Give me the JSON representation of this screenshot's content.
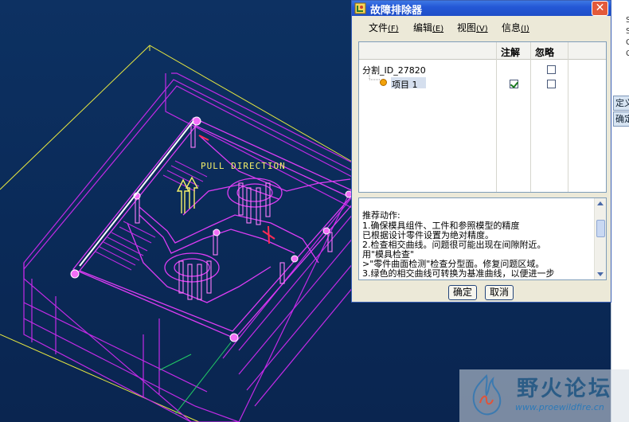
{
  "viewport": {
    "pull_direction_label": "PULL DIRECTION",
    "colors": {
      "background": "#0b2c5a",
      "outline_primary": "#cc2cf0",
      "outline_secondary": "#ff8cff",
      "boundary": "#e8e840",
      "highlight": "#ffffff",
      "edge_green": "#22cc66"
    }
  },
  "dialog": {
    "title": "故障排除器",
    "close_label": "✕",
    "menu": [
      {
        "label": "文件",
        "key": "(F)"
      },
      {
        "label": "编辑",
        "key": "(E)"
      },
      {
        "label": "视图",
        "key": "(V)"
      },
      {
        "label": "信息",
        "key": "(I)"
      }
    ],
    "tree": {
      "columns": [
        "注解",
        "忽略"
      ],
      "rows": [
        {
          "label": "分割_ID_27820",
          "annotate": false,
          "ignore": false
        },
        {
          "label": "项目 1",
          "annotate": true,
          "ignore": false
        }
      ]
    },
    "info": {
      "lines": [
        "推荐动作:",
        "1.确保模具组件、工件和参照模型的精度",
        "    已根据设计零件设置为绝对精度。",
        "2.检查相交曲线。问题很可能出现在间隙附近。",
        "    用\"模具检查\"",
        ">\"零件曲面检测\"检查分型面。修复问题区域。",
        "3.绿色的相交曲线可转换为基准曲线，以便进一步"
      ]
    },
    "buttons": {
      "ok": "确定",
      "cancel": "取消"
    }
  },
  "side_panel": {
    "lines": [
      "S",
      "S",
      "G",
      "C"
    ],
    "button_top": "定义",
    "button_bottom": "确定"
  },
  "watermark": {
    "title": "野火论坛",
    "url": "www.proewildfire.cn"
  }
}
